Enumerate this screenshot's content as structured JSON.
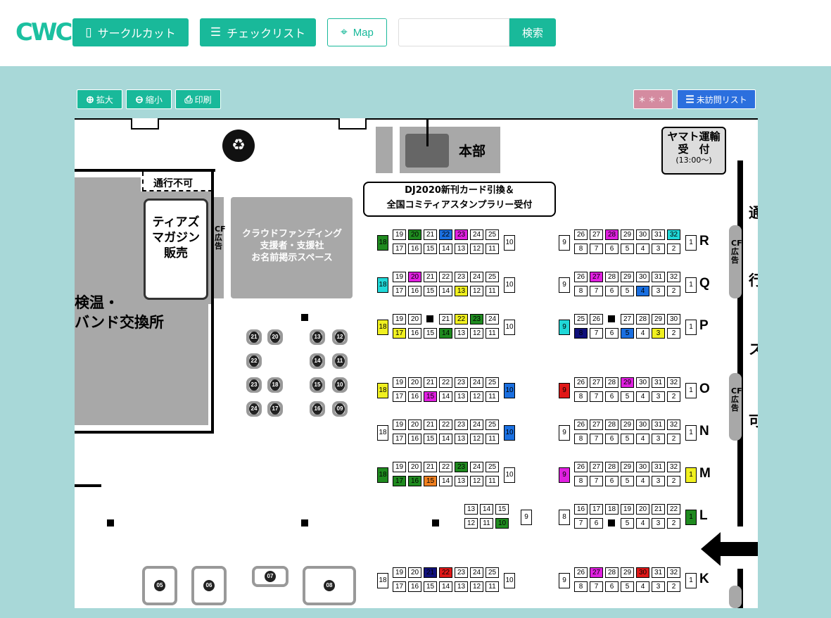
{
  "header": {
    "logo": "CWC",
    "circle_cut_label": "サークルカット",
    "checklist_label": "チェックリスト",
    "map_label": "Map",
    "search_placeholder": "",
    "search_label": "検索"
  },
  "toolbar": {
    "zoom_in_label": "拡大",
    "zoom_out_label": "縮小",
    "print_label": "印刷",
    "masked_label": "＊＊＊",
    "unvisited_label": "未訪問リスト"
  },
  "map": {
    "honbu": "本部",
    "yamato_1": "ヤマト運輸",
    "yamato_2": "受　付",
    "yamato_3": "(13:00〜)",
    "dj_1": "DJ2020新刊カード引換＆",
    "dj_2": "全国コミティアスタンプラリー受付",
    "no_pass": "通行不可",
    "tiaz_1": "ティアズ",
    "tiaz_2": "マガジン",
    "tiaz_3": "販売",
    "cf_ad": "CF広告",
    "crowd_1": "クラウドファンディング",
    "crowd_2": "支援者・支援社",
    "crowd_3": "お名前掲示スペース",
    "kenon_1": "検温・",
    "kenon_2": "バンド交換所",
    "right_text_1": "通",
    "right_text_2": "行",
    "right_text_3": "ス",
    "right_text_4": "可",
    "rows": [
      "R",
      "Q",
      "P",
      "O",
      "N",
      "M",
      "L",
      "K"
    ]
  },
  "colors": {
    "accent": "#19b99a",
    "background": "#a8d8d8",
    "blue_button": "#2b6fde",
    "pink_button": "#d48ba0"
  },
  "icons": [
    "circle-cut-icon",
    "checklist-icon",
    "map-icon",
    "zoom-in-icon",
    "zoom-out-icon",
    "print-icon",
    "list-icon",
    "trash-icon",
    "exit-icon"
  ]
}
